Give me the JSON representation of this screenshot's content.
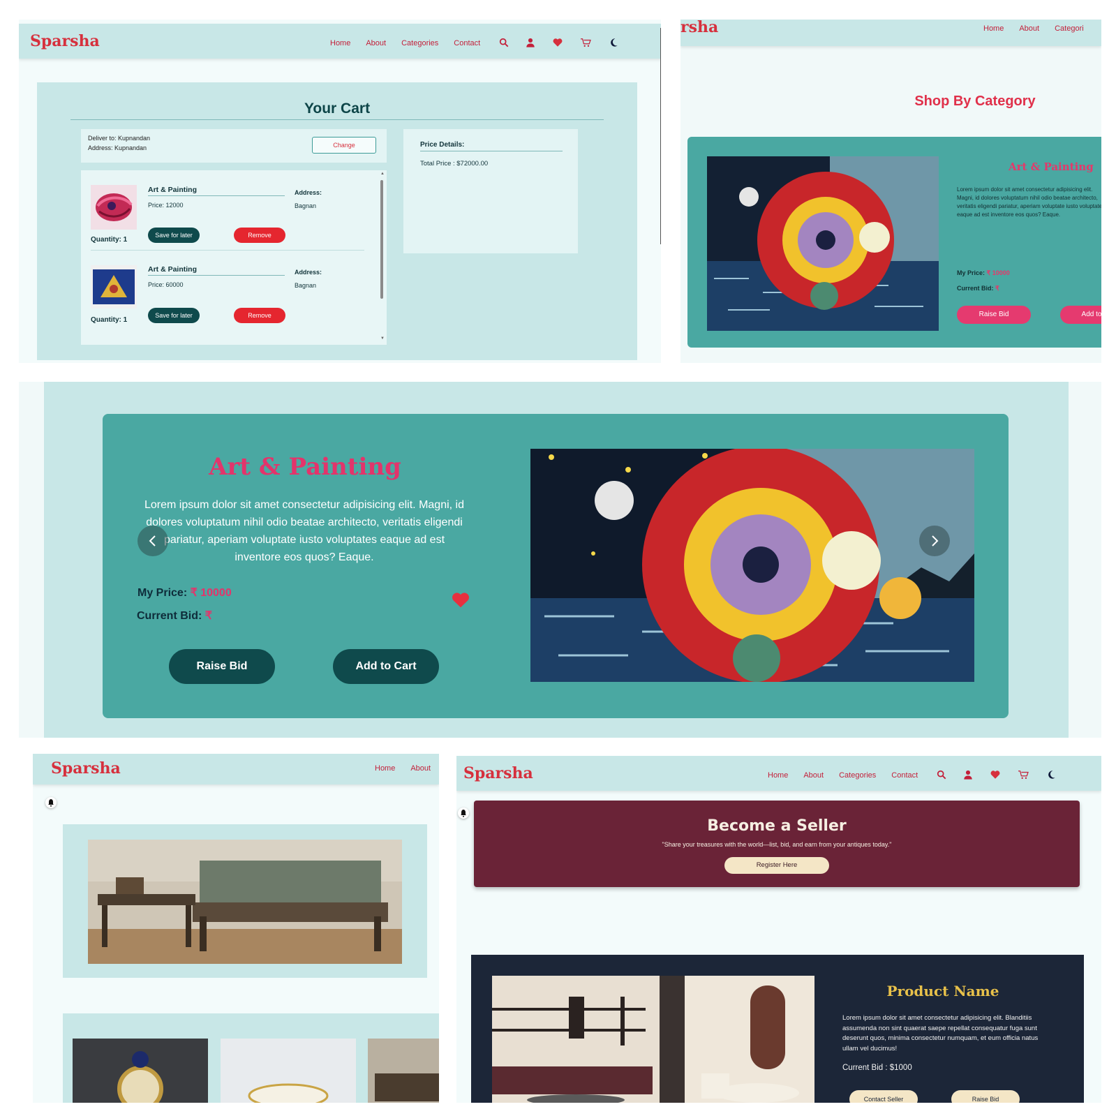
{
  "brand": {
    "logo": "Sparsha",
    "logo_partial": "rsha"
  },
  "nav": {
    "home": "Home",
    "about": "About",
    "categories": "Categories",
    "categories_partial": "Categori",
    "contact": "Contact"
  },
  "icons": [
    "search-icon",
    "user-icon",
    "heart-icon",
    "cart-icon",
    "moon-icon",
    "bell-icon"
  ],
  "colors": {
    "brand_red": "#d6303d",
    "mint": "#c8e7e7",
    "teal": "#4aa8a2",
    "dark_teal": "#0f4a4c",
    "maroon": "#6a2337",
    "navy": "#1c2638",
    "pink": "#e53a6f",
    "gold": "#e8c14a"
  },
  "cart": {
    "title": "Your Cart",
    "deliver_to": "Deliver to: Kupnandan",
    "address": "Address: Kupnandan",
    "change": "Change",
    "items": [
      {
        "name": "Art & Painting",
        "price": "Price: 12000",
        "address_label": "Address:",
        "address_value": "Bagnan",
        "quantity": "Quantity: 1",
        "save": "Save for later",
        "remove": "Remove"
      },
      {
        "name": "Art & Painting",
        "price": "Price: 60000",
        "address_label": "Address:",
        "address_value": "Bagnan",
        "quantity": "Quantity: 1",
        "save": "Save for later",
        "remove": "Remove"
      }
    ],
    "price_details": "Price Details:",
    "total": "Total Price : $72000.00"
  },
  "category": {
    "heading": "Shop By Category",
    "card_title": "Art & Painting",
    "card_desc": "Lorem ipsum dolor sit amet consectetur adipisicing elit. Magni, id dolores voluptatum nihil odio beatae architecto, veritatis eligendi pariatur, aperiam voluptate iusto voluptates eaque ad est inventore eos quos? Eaque.",
    "my_price_label": "My Price:",
    "my_price_value": "₹ 10000",
    "current_bid_label": "Current Bid:",
    "current_bid_value": "₹",
    "raise_bid": "Raise Bid",
    "add_partial": "Add to"
  },
  "hero": {
    "title": "Art & Painting",
    "desc": "Lorem ipsum dolor sit amet consectetur adipisicing elit. Magni, id dolores voluptatum nihil odio beatae architecto, veritatis eligendi pariatur, aperiam voluptate iusto voluptates eaque ad est inventore eos quos? Eaque.",
    "my_price_label": "My Price:",
    "my_price_value": "₹ 10000",
    "current_bid_label": "Current Bid:",
    "current_bid_value": "₹",
    "raise_bid": "Raise Bid",
    "add_to_cart": "Add to Cart"
  },
  "seller": {
    "title": "Become a Seller",
    "quote": "\"Share your treasures with the world—list, bid, and earn from your antiques today.\"",
    "register": "Register Here"
  },
  "product": {
    "name": "Product Name",
    "desc": "Lorem ipsum dolor sit amet consectetur adipisicing elit. Blanditiis assumenda non sint quaerat saepe repellat consequatur fuga sunt deserunt quos, minima consectetur numquam, et eum officia natus ullam vel ducimus!",
    "bid": "Current Bid : $1000",
    "contact": "Contact Seller",
    "raise": "Raise Bid"
  }
}
